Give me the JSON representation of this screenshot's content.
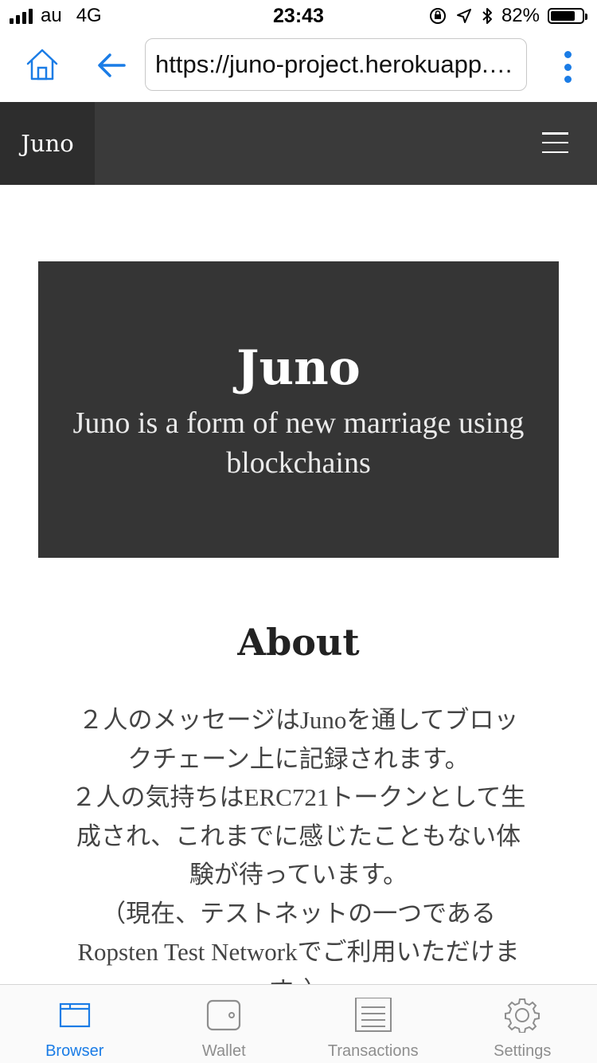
{
  "status_bar": {
    "carrier": "au",
    "network": "4G",
    "time": "23:43",
    "battery_percent": "82%",
    "battery_level": 0.82
  },
  "browser": {
    "url": "https://juno-project.herokuapp.com",
    "accent_color": "#1a7ce6"
  },
  "nav": {
    "brand": "Juno",
    "menu_icon": "hamburger-icon"
  },
  "hero": {
    "title": "Juno",
    "subtitle": "Juno is a form of new marriage using blockchains"
  },
  "about": {
    "title": "About",
    "paragraphs": [
      "２人のメッセージはJunoを通してブロックチェーン上に記録されます。",
      "２人の気持ちはERC721トークンとして生成され、これまでに感じたこともない体験が待っています。",
      "（現在、テストネットの一つであるRopsten Test Networkでご利用いただけます。）"
    ]
  },
  "tabs": [
    {
      "label": "Browser",
      "icon": "browser-icon",
      "active": true
    },
    {
      "label": "Wallet",
      "icon": "wallet-icon",
      "active": false
    },
    {
      "label": "Transactions",
      "icon": "transactions-icon",
      "active": false
    },
    {
      "label": "Settings",
      "icon": "settings-icon",
      "active": false
    }
  ]
}
